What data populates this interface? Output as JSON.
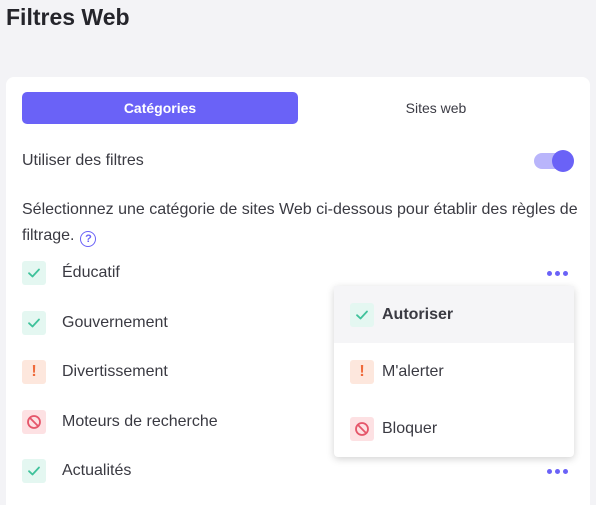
{
  "page": {
    "title": "Filtres Web"
  },
  "tabs": [
    {
      "label": "Catégories",
      "active": true
    },
    {
      "label": "Sites web",
      "active": false
    }
  ],
  "filter_toggle": {
    "label": "Utiliser des filtres",
    "enabled": true
  },
  "description": "Sélectionnez une catégorie de sites Web ci-dessous pour établir des règles de filtrage.",
  "help_glyph": "?",
  "categories": [
    {
      "label": "Éducatif",
      "status": "allow",
      "icon": "check-icon"
    },
    {
      "label": "Gouvernement",
      "status": "allow",
      "icon": "check-icon"
    },
    {
      "label": "Divertissement",
      "status": "warn",
      "icon": "exclamation-icon"
    },
    {
      "label": "Moteurs de recherche",
      "status": "block",
      "icon": "block-icon"
    },
    {
      "label": "Actualités",
      "status": "allow",
      "icon": "check-icon"
    }
  ],
  "menu": {
    "items": [
      {
        "label": "Autoriser",
        "icon": "check-icon",
        "selected": true
      },
      {
        "label": "M'alerter",
        "icon": "exclamation-icon",
        "selected": false
      },
      {
        "label": "Bloquer",
        "icon": "block-icon",
        "selected": false
      }
    ]
  },
  "colors": {
    "accent": "#6a62f7",
    "allow": "#3fc29b",
    "warn": "#ef6a3b",
    "block": "#e5566a"
  }
}
